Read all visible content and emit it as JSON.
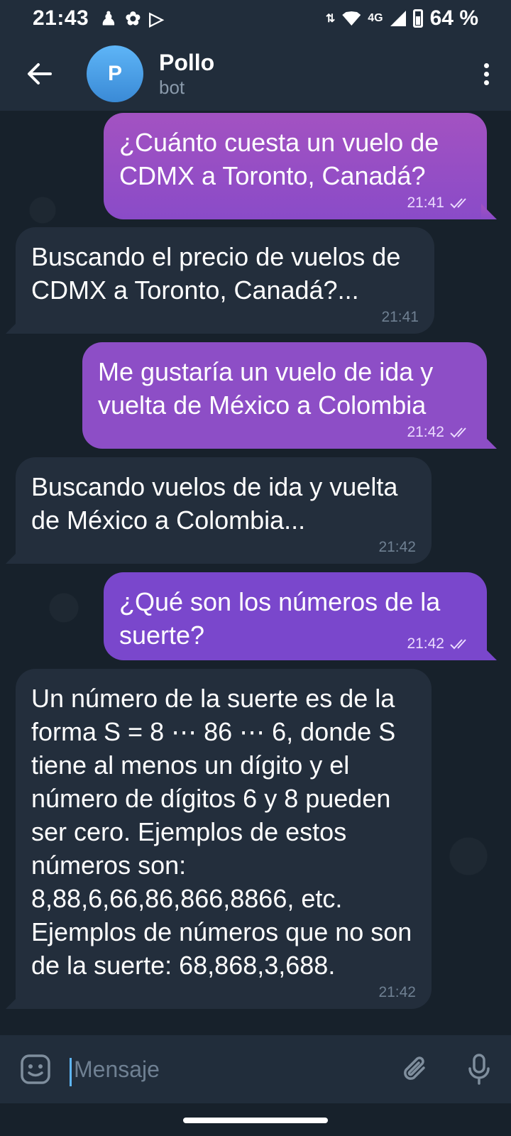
{
  "status_bar": {
    "time": "21:43",
    "network": "4G",
    "battery": "64 %"
  },
  "header": {
    "avatar_letter": "P",
    "chat_name": "Pollo",
    "chat_subtitle": "bot"
  },
  "messages": [
    {
      "direction": "outgoing",
      "text": "¿Cuánto cuesta un vuelo de CDMX a Toronto, Canadá?",
      "time": "21:41",
      "read": true
    },
    {
      "direction": "incoming",
      "text": "Buscando el precio de vuelos de CDMX a Toronto, Canadá?...",
      "time": "21:41"
    },
    {
      "direction": "outgoing",
      "text": "Me gustaría un vuelo de ida y vuelta de México a Colombia",
      "time": "21:42",
      "read": true
    },
    {
      "direction": "incoming",
      "text": "Buscando vuelos de ida y vuelta de México a Colombia...",
      "time": "21:42"
    },
    {
      "direction": "outgoing",
      "text": "¿Qué son los números de la suerte?",
      "time": "21:42",
      "read": true
    },
    {
      "direction": "incoming",
      "text": "Un número de la suerte es de la forma S = 8 ⋯ 86 ⋯ 6, donde S tiene al menos un dígito y el número de dígitos 6 y 8 pueden ser cero. Ejemplos de estos números son: 8,88,6,66,86,866,8866, etc. Ejemplos de números que no son de la suerte: 68,868,3,688.",
      "time": "21:42"
    }
  ],
  "composer": {
    "placeholder": "Mensaje"
  }
}
